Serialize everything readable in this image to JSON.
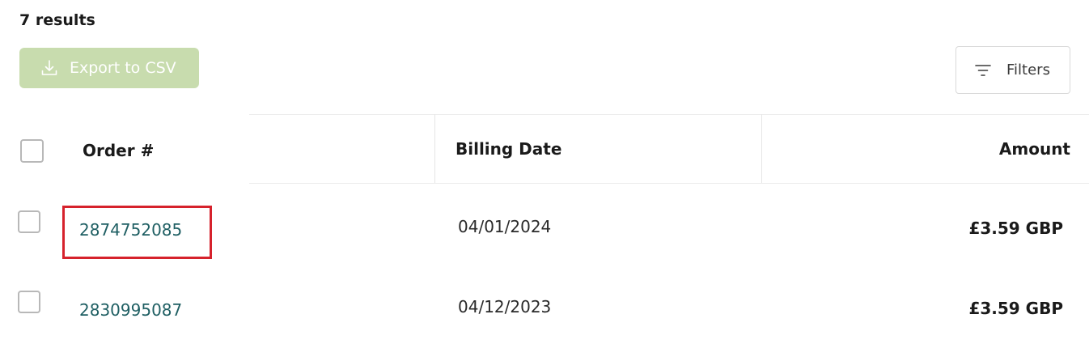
{
  "results": {
    "count_label": "7 results"
  },
  "toolbar": {
    "export_label": "Export to CSV",
    "export_icon": "download-icon",
    "filters_label": "Filters",
    "filters_icon": "filter-lines-icon"
  },
  "table": {
    "headers": {
      "order": "Order #",
      "billing_date": "Billing Date",
      "amount": "Amount"
    },
    "rows": [
      {
        "order_number": "2874752085",
        "billing_date": "04/01/2024",
        "amount": "£3.59 GBP",
        "highlighted": true
      },
      {
        "order_number": "2830995087",
        "billing_date": "04/12/2023",
        "amount": "£3.59 GBP",
        "highlighted": false
      }
    ]
  },
  "colors": {
    "export_button_bg": "#c8dcae",
    "link_color": "#1f5f63",
    "highlight_border": "#d6222c",
    "border": "#d9d9d9"
  }
}
